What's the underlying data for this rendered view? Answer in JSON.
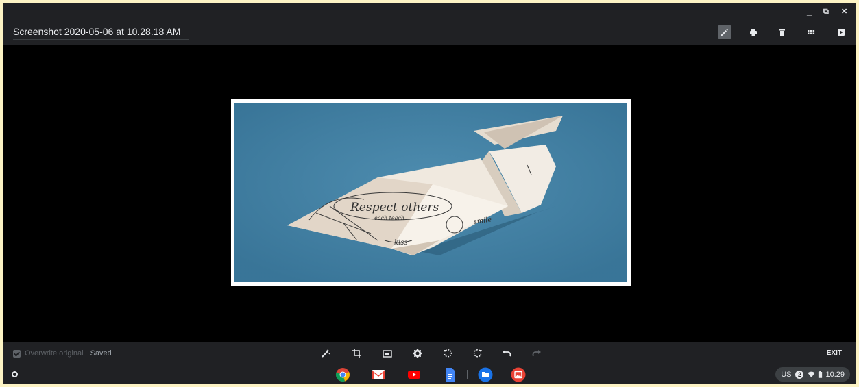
{
  "file": {
    "name": "Screenshot 2020-05-06 at 10.28.18 AM"
  },
  "window_controls": {
    "minimize": "_",
    "restore": "⧉",
    "close": "✕"
  },
  "header_tools": [
    {
      "name": "edit-icon",
      "active": true
    },
    {
      "name": "print-icon"
    },
    {
      "name": "delete-icon"
    },
    {
      "name": "gallery-icon"
    },
    {
      "name": "slideshow-icon"
    }
  ],
  "editbar": {
    "overwrite_label": "Overwrite original",
    "saved_label": "Saved",
    "exit_label": "EXIT",
    "tools": [
      "auto-fix-icon",
      "crop-icon",
      "resize-icon",
      "brightness-icon",
      "rotate-left-icon",
      "rotate-right-icon",
      "undo-icon",
      "redo-icon"
    ]
  },
  "photo": {
    "background_color": "#3f7fa3",
    "drawn_text": [
      "Respect others",
      "each teach",
      "smile",
      "kiss"
    ]
  },
  "shelf": {
    "apps": [
      "chrome-icon",
      "gmail-icon",
      "youtube-icon",
      "docs-icon",
      "files-icon",
      "gallery-app-icon"
    ],
    "tray": {
      "locale": "US",
      "notifications": "2",
      "time": "10:29"
    }
  },
  "colors": {
    "chrome": "#202124",
    "accent_text": "#e8eaed"
  }
}
